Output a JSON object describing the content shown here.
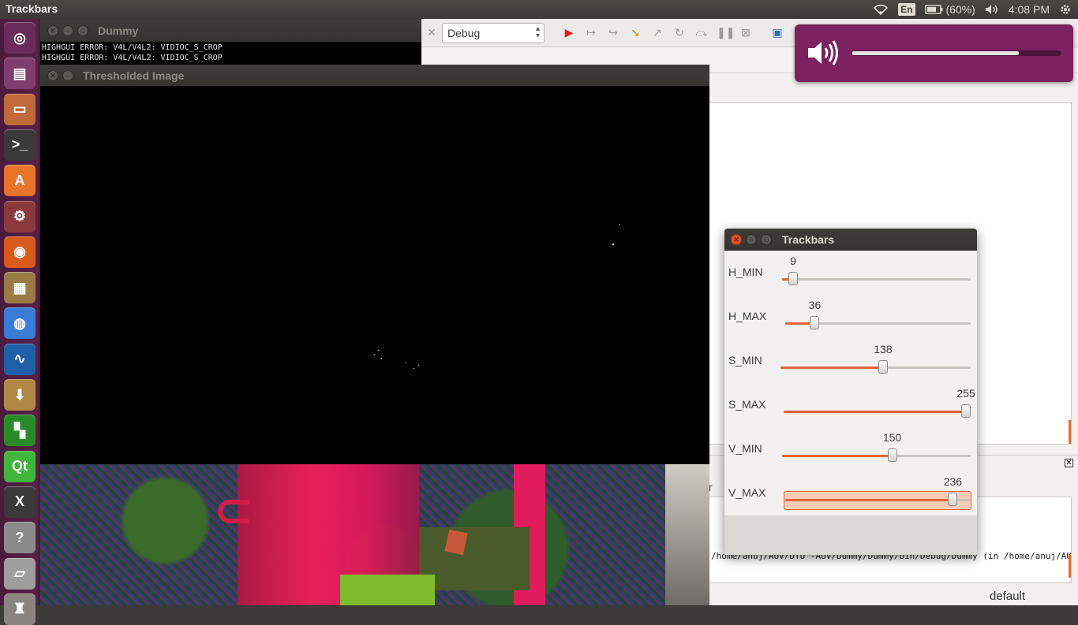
{
  "top_panel": {
    "title": "Trackbars",
    "lang": "En",
    "battery": "(60%)",
    "time": "4:08 PM"
  },
  "launcher": {
    "items": [
      {
        "icon": "ubuntu-dash-icon",
        "color": "#6a2c5a"
      },
      {
        "icon": "workspace-icon",
        "color": "#7f3d6e"
      },
      {
        "icon": "files-icon",
        "color": "#c1693b"
      },
      {
        "icon": "terminal-icon",
        "color": "#3a3a3a"
      },
      {
        "icon": "software-center-icon",
        "color": "#e8742c"
      },
      {
        "icon": "system-settings-icon",
        "color": "#8a3a3a"
      },
      {
        "icon": "firefox-icon",
        "color": "#d85a1c"
      },
      {
        "icon": "archive-manager-icon",
        "color": "#9a7b45"
      },
      {
        "icon": "chromium-icon",
        "color": "#3a7bd5"
      },
      {
        "icon": "system-monitor-icon",
        "color": "#1f5fa8"
      },
      {
        "icon": "package-installer-icon",
        "color": "#b08845"
      },
      {
        "icon": "codeblocks-icon",
        "color": "#2a8a2a"
      },
      {
        "icon": "qt-creator-icon",
        "color": "#41b43c"
      },
      {
        "icon": "xterm-icon",
        "color": "#3a3a3a"
      },
      {
        "icon": "help-icon",
        "color": "#8a8a8a"
      },
      {
        "icon": "drive-icon",
        "color": "#9e9e9e"
      },
      {
        "icon": "trash-icon",
        "color": "#8a8580"
      }
    ]
  },
  "ide": {
    "build_target": "Debug",
    "log_line": "/home/anuj/AUV/DTU -AUV/Dummy/Dummy/bin/Debug/Dummy  (in /home/anuj/AUV/DTU",
    "panel_tab": "r",
    "status": "default"
  },
  "dummy_window": {
    "title": "Dummy",
    "console_lines": [
      "HIGHGUI ERROR: V4L/V4L2: VIDIOC_S_CROP",
      "HIGHGUI ERROR: V4L/V4L2: VIDIOC_S_CROP"
    ]
  },
  "threshold_window": {
    "title": "Thresholded Image"
  },
  "trackbars_window": {
    "title": "Trackbars",
    "accent": "#e0643a",
    "bars": [
      {
        "label": "H_MIN",
        "value": "9",
        "max": 255
      },
      {
        "label": "H_MAX",
        "value": "36",
        "max": 255
      },
      {
        "label": "S_MIN",
        "value": "138",
        "max": 255
      },
      {
        "label": "S_MAX",
        "value": "255",
        "max": 255
      },
      {
        "label": "V_MIN",
        "value": "150",
        "max": 255
      },
      {
        "label": "V_MAX",
        "value": "236",
        "max": 255
      }
    ]
  },
  "volume_osd": {
    "level_fraction": 0.8
  }
}
